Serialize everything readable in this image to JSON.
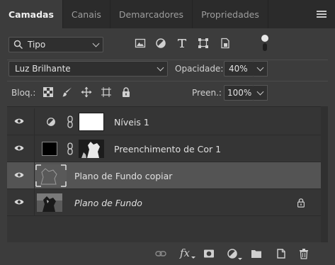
{
  "tabs": [
    {
      "label": "Camadas",
      "active": true
    },
    {
      "label": "Canais",
      "active": false
    },
    {
      "label": "Demarcadores",
      "active": false
    },
    {
      "label": "Propriedades",
      "active": false
    }
  ],
  "filter": {
    "kind_label": "Tipo",
    "icons": [
      "pixel-filter-icon",
      "adjustment-filter-icon",
      "type-filter-icon",
      "shape-filter-icon",
      "smart-object-filter-icon"
    ]
  },
  "blend": {
    "mode": "Luz Brilhante",
    "opacity_label": "Opacidade:",
    "opacity_value": "40%"
  },
  "lock": {
    "label": "Bloq.:",
    "fill_label": "Preen.:",
    "fill_value": "100%"
  },
  "layers": [
    {
      "name": "Níveis 1",
      "italic": false,
      "selected": false,
      "locked": false
    },
    {
      "name": "Preenchimento de Cor 1",
      "italic": false,
      "selected": false,
      "locked": false
    },
    {
      "name": "Plano de Fundo copiar",
      "italic": false,
      "selected": true,
      "locked": false
    },
    {
      "name": "Plano de Fundo",
      "italic": true,
      "selected": false,
      "locked": true
    }
  ],
  "footer": {
    "fx_label": "fx"
  },
  "colors": {
    "panel_bg": "#3c3c3c",
    "tab_bar_bg": "#2b2b2b",
    "selected_row": "#545454"
  }
}
